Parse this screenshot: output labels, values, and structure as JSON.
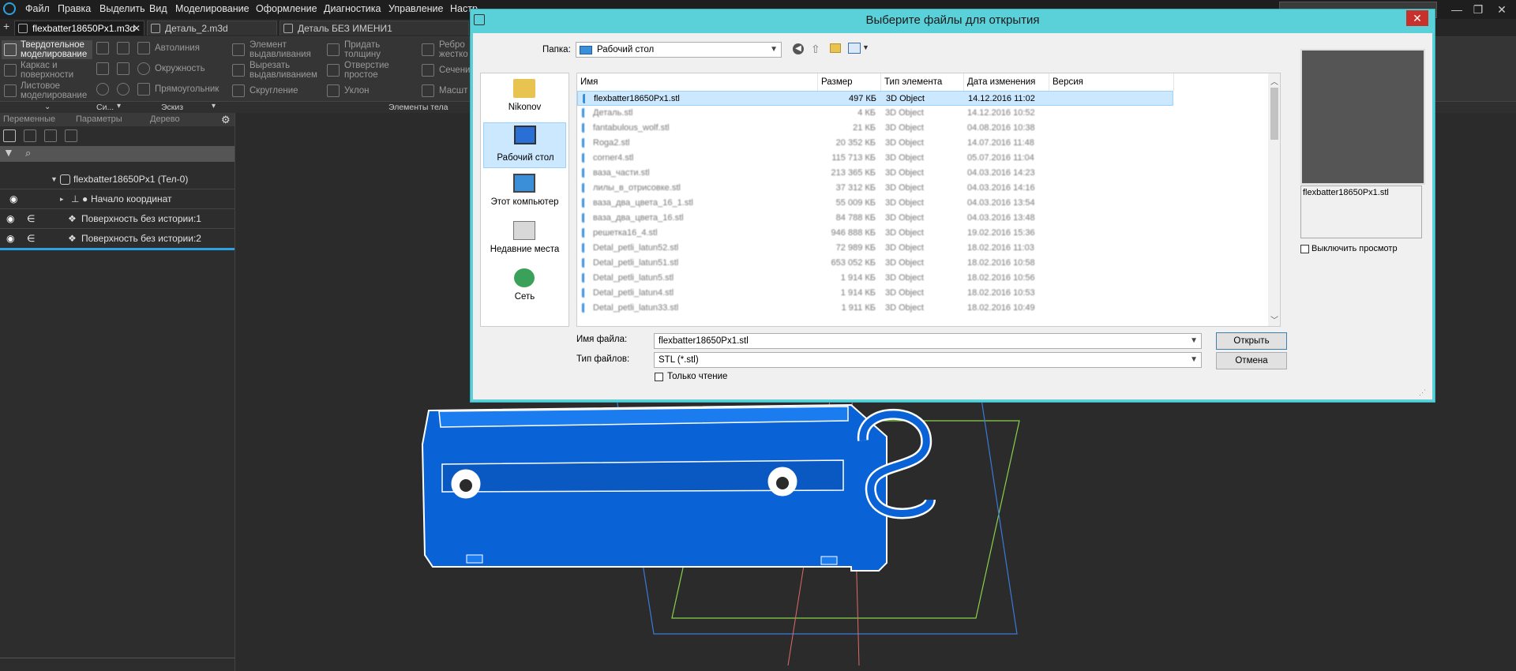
{
  "menu": {
    "items": [
      "Файл",
      "Правка",
      "Выделить",
      "Вид",
      "Моделирование",
      "Оформление",
      "Диагностика",
      "Управление",
      "Настр"
    ]
  },
  "window_buttons": {
    "minimize": "—",
    "restore": "❐",
    "close": "✕"
  },
  "tabs": [
    {
      "label": "flexbatter18650Px1.m3d",
      "close": "✕"
    },
    {
      "label": "Деталь_2.m3d"
    },
    {
      "label": "Деталь БЕЗ ИМЕНИ1"
    }
  ],
  "ribbon": {
    "modes": [
      "Твердотельное моделирование",
      "Каркас и поверхности",
      "Листовое моделирование"
    ],
    "sketch_tools": [
      "Автолиния",
      "Окружность",
      "Прямоугольник"
    ],
    "body_tools": [
      "Элемент выдавливания",
      "Вырезать выдавливанием",
      "Скругление"
    ],
    "body_tools2": [
      "Придать толщину",
      "Отверстие простое",
      "Уклон"
    ],
    "body_tools3": [
      "Ребро жестко",
      "Сечени",
      "Масшт"
    ],
    "groups": [
      "Си...",
      "Эскиз",
      "Элементы тела"
    ]
  },
  "panel": {
    "tabs": [
      "Переменные",
      "Параметры",
      "Дерево"
    ],
    "tree": [
      {
        "label": "flexbatter18650Px1 (Тел-0)"
      },
      {
        "label": "Начало координат"
      },
      {
        "label": "Поверхность без истории:1"
      },
      {
        "label": "Поверхность без истории:2"
      }
    ]
  },
  "dialog": {
    "title": "Выберите файлы для открытия",
    "close": "✕",
    "folder_label": "Папка:",
    "folder_value": "Рабочий стол",
    "places": [
      "Nikonov",
      "Рабочий стол",
      "Этот компьютер",
      "Недавние места",
      "Сеть"
    ],
    "columns": [
      "Имя",
      "Размер",
      "Тип элемента",
      "Дата изменения",
      "Версия"
    ],
    "files": [
      {
        "name": "flexbatter18650Px1.stl",
        "size": "497 КБ",
        "type": "3D Object",
        "date": "14.12.2016 11:02"
      },
      {
        "name": "Деталь.stl",
        "size": "4 КБ",
        "type": "3D Object",
        "date": "14.12.2016 10:52"
      },
      {
        "name": "fantabulous_wolf.stl",
        "size": "21 КБ",
        "type": "3D Object",
        "date": "04.08.2016 10:38"
      },
      {
        "name": "Roga2.stl",
        "size": "20 352 КБ",
        "type": "3D Object",
        "date": "14.07.2016 11:48"
      },
      {
        "name": "corner4.stl",
        "size": "115 713 КБ",
        "type": "3D Object",
        "date": "05.07.2016 11:04"
      },
      {
        "name": "ваза_части.stl",
        "size": "213 365 КБ",
        "type": "3D Object",
        "date": "04.03.2016 14:23"
      },
      {
        "name": "лилы_в_отрисовке.stl",
        "size": "37 312 КБ",
        "type": "3D Object",
        "date": "04.03.2016 14:16"
      },
      {
        "name": "ваза_два_цвета_16_1.stl",
        "size": "55 009 КБ",
        "type": "3D Object",
        "date": "04.03.2016 13:54"
      },
      {
        "name": "ваза_два_цвета_16.stl",
        "size": "84 788 КБ",
        "type": "3D Object",
        "date": "04.03.2016 13:48"
      },
      {
        "name": "решетка16_4.stl",
        "size": "946 888 КБ",
        "type": "3D Object",
        "date": "19.02.2016 15:36"
      },
      {
        "name": "Detal_petli_latun52.stl",
        "size": "72 989 КБ",
        "type": "3D Object",
        "date": "18.02.2016 11:03"
      },
      {
        "name": "Detal_petli_latun51.stl",
        "size": "653 052 КБ",
        "type": "3D Object",
        "date": "18.02.2016 10:58"
      },
      {
        "name": "Detal_petli_latun5.stl",
        "size": "1 914 КБ",
        "type": "3D Object",
        "date": "18.02.2016 10:56"
      },
      {
        "name": "Detal_petli_latun4.stl",
        "size": "1 914 КБ",
        "type": "3D Object",
        "date": "18.02.2016 10:53"
      },
      {
        "name": "Detal_petli_latun33.stl",
        "size": "1 911 КБ",
        "type": "3D Object",
        "date": "18.02.2016 10:49"
      }
    ],
    "filename_label": "Имя файла:",
    "filename_value": "flexbatter18650Px1.stl",
    "filetype_label": "Тип файлов:",
    "filetype_value": "STL (*.stl)",
    "readonly_label": "Только чтение",
    "open_button": "Открыть",
    "cancel_button": "Отмена",
    "preview_name": "flexbatter18650Px1.stl",
    "disable_preview": "Выключить просмотр"
  }
}
